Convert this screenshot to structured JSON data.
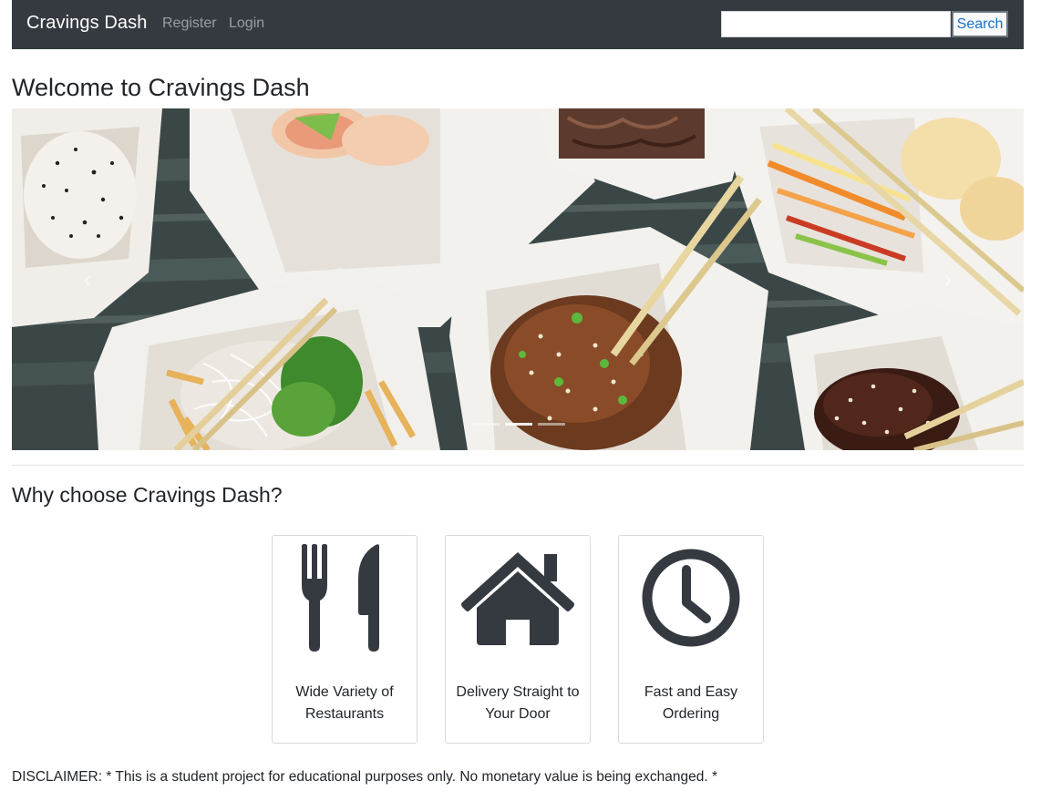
{
  "navbar": {
    "brand": "Cravings Dash",
    "links": [
      "Register",
      "Login"
    ],
    "search": {
      "placeholder": "",
      "value": "",
      "button_label": "Search"
    },
    "background": "#343a40"
  },
  "main": {
    "title": "Welcome to Cravings Dash",
    "carousel": {
      "prev_glyph": "‹",
      "next_glyph": "›",
      "slide_count": 3,
      "active_slide": 1
    },
    "why_heading": "Why choose Cravings Dash?",
    "features": [
      {
        "icon": "utensils-icon",
        "text": "Wide Variety of Restaurants"
      },
      {
        "icon": "home-icon",
        "text": "Delivery Straight to Your Door"
      },
      {
        "icon": "clock-icon",
        "text": "Fast and Easy Ordering"
      }
    ],
    "icon_color": "#343a40"
  },
  "footer": {
    "disclaimer": "DISCLAIMER: * This is a student project for educational purposes only. No monetary value is being exchanged. *"
  }
}
